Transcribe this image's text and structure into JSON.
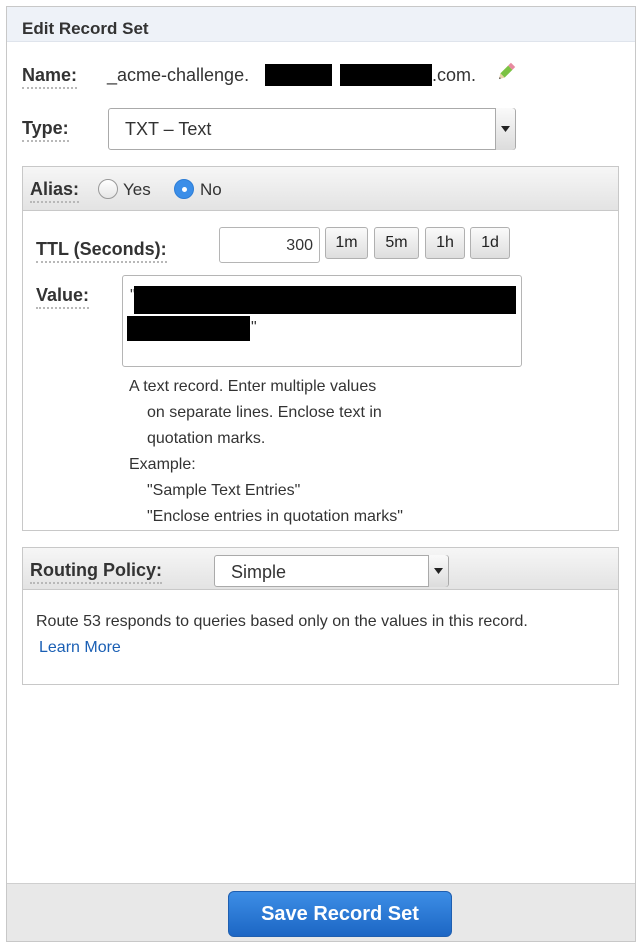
{
  "panel": {
    "title": "Edit Record Set"
  },
  "name": {
    "label": "Name:",
    "prefix": "_acme-challenge.",
    "suffix": ".com."
  },
  "type": {
    "label": "Type:",
    "value": "TXT – Text"
  },
  "alias": {
    "label": "Alias:",
    "options": [
      "Yes",
      "No"
    ],
    "selected": "No"
  },
  "ttl": {
    "label": "TTL (Seconds):",
    "value": "300",
    "presets": [
      "1m",
      "5m",
      "1h",
      "1d"
    ]
  },
  "value": {
    "label": "Value:",
    "quote_open": "\"",
    "quote_close": "\"",
    "help_lines": [
      "A text record. Enter multiple values",
      "on separate lines. Enclose text in",
      "quotation marks.",
      "Example:",
      "\"Sample Text Entries\"",
      "\"Enclose entries in quotation marks\""
    ]
  },
  "routing": {
    "label": "Routing Policy:",
    "value": "Simple",
    "description": "Route 53 responds to queries based only on the values in this record.",
    "learn_more": "Learn More"
  },
  "footer": {
    "save_label": "Save Record Set"
  },
  "colors": {
    "accent": "#3b8ee8",
    "link": "#1a5fb4",
    "header_bg": "#eef2f8"
  }
}
